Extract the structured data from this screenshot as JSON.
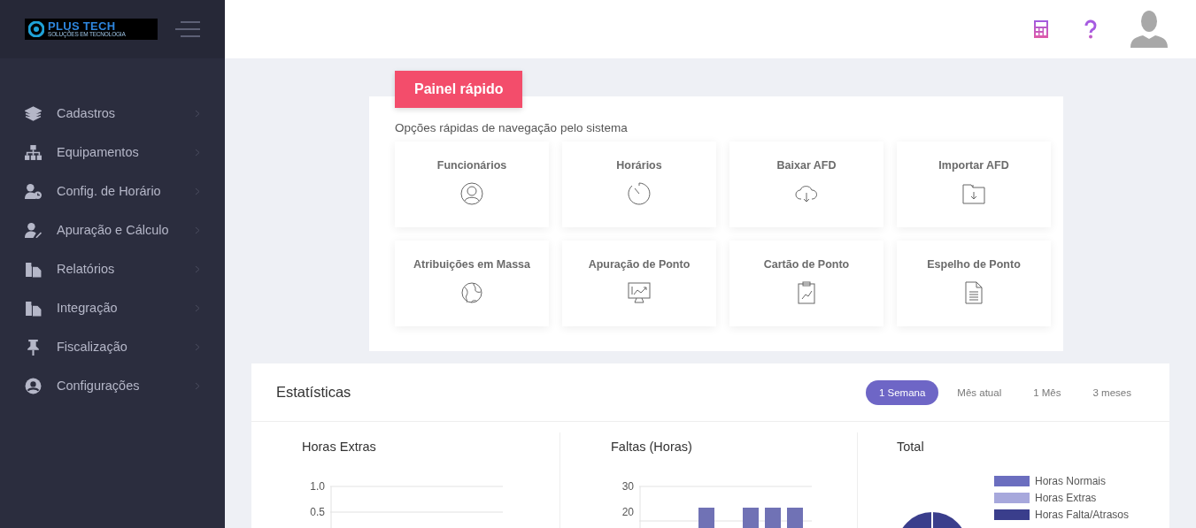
{
  "logo": {
    "title": "PLUS TECH",
    "tagline": "SOLUÇÕES EM TECNOLOGIA"
  },
  "sidebar": {
    "items": [
      {
        "label": "Cadastros"
      },
      {
        "label": "Equipamentos"
      },
      {
        "label": "Config. de Horário"
      },
      {
        "label": "Apuração e Cálculo"
      },
      {
        "label": "Relatórios"
      },
      {
        "label": "Integração"
      },
      {
        "label": "Fiscalização"
      },
      {
        "label": "Configurações"
      }
    ]
  },
  "quick_panel": {
    "tag": "Painel rápido",
    "subtitle": "Opções rápidas de navegação pelo sistema",
    "tiles": [
      {
        "label": "Funcionários"
      },
      {
        "label": "Horários"
      },
      {
        "label": "Baixar AFD"
      },
      {
        "label": "Importar AFD"
      },
      {
        "label": "Atribuições em Massa"
      },
      {
        "label": "Apuração de Ponto"
      },
      {
        "label": "Cartão de Ponto"
      },
      {
        "label": "Espelho de Ponto"
      }
    ]
  },
  "statistics": {
    "title": "Estatísticas",
    "periods": [
      {
        "label": "1 Semana",
        "selected": true
      },
      {
        "label": "Mês atual",
        "selected": false
      },
      {
        "label": "1 Mês",
        "selected": false
      },
      {
        "label": "3 meses",
        "selected": false
      }
    ],
    "panels": [
      {
        "title": "Horas Extras",
        "y_tick_labels": [
          "1.0",
          "0.5"
        ]
      },
      {
        "title": "Faltas (Horas)",
        "y_tick_labels": [
          "30",
          "20"
        ]
      },
      {
        "title": "Total",
        "legend": [
          {
            "label": "Horas Normais",
            "color": "#6b6ebf"
          },
          {
            "label": "Horas Extras",
            "color": "#a7a8dc"
          },
          {
            "label": "Horas Falta/Atrasos",
            "color": "#3a3e8c"
          }
        ]
      }
    ]
  }
}
